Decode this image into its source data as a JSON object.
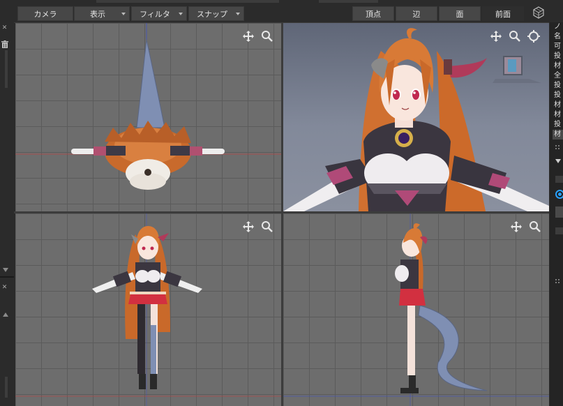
{
  "toolbar": {
    "camera_label": "カメラ",
    "view_label": "表示",
    "filter_label": "フィルタ",
    "snap_label": "スナップ",
    "vertex_label": "頂点",
    "edge_label": "辺",
    "face_label": "面",
    "front_label": "前面"
  },
  "right_panel": {
    "items": [
      "ノ",
      "名",
      "可",
      "投",
      "材",
      "全",
      "投",
      "投",
      "材",
      "材",
      "投",
      "材"
    ]
  },
  "colors": {
    "axis_red": "#c04040",
    "axis_blue": "#4050c0",
    "accent_ring": "#28a0ff"
  },
  "icons": {
    "move": "move-icon",
    "zoom": "zoom-icon",
    "rotate": "rotate-icon",
    "cube": "view-cube-icon"
  }
}
